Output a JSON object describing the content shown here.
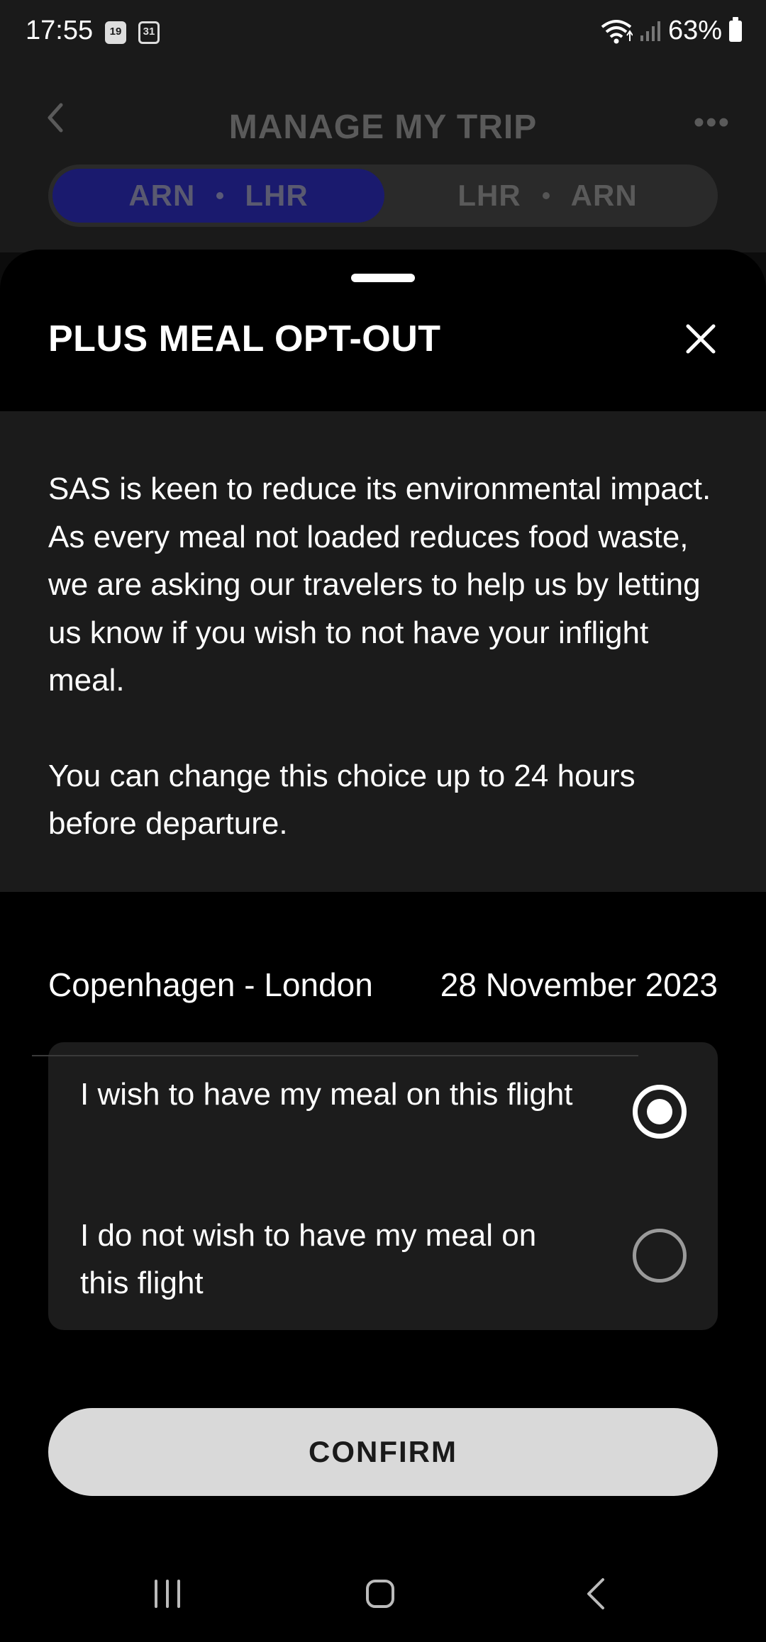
{
  "status_bar": {
    "time": "17:55",
    "calendar_icon_1": "19",
    "calendar_icon_2": "31",
    "battery_percent": "63%"
  },
  "header": {
    "title": "MANAGE MY TRIP",
    "more_label": "•••"
  },
  "route_tabs": [
    {
      "from": "ARN",
      "to": "LHR",
      "active": true
    },
    {
      "from": "LHR",
      "to": "ARN",
      "active": false
    }
  ],
  "sheet": {
    "title": "PLUS MEAL OPT-OUT",
    "info_paragraph_1": "SAS is keen to reduce its environmental impact. As every meal not loaded reduces food waste, we are asking our travelers to help us by letting us know if you wish to not have your inflight meal.",
    "info_paragraph_2": "You can change this choice up to 24 hours before departure.",
    "trip_route": "Copenhagen - London",
    "trip_date": "28 November 2023",
    "options": [
      {
        "label": "I wish to have my meal on this flight",
        "selected": true
      },
      {
        "label": "I do not wish to have my meal on this flight",
        "selected": false
      }
    ],
    "confirm_label": "CONFIRM"
  },
  "colors": {
    "sheet_bg": "#000000",
    "panel_bg": "#1b1b1b",
    "active_tab": "#1a1a6e",
    "confirm_bg": "#d9d9d9"
  }
}
